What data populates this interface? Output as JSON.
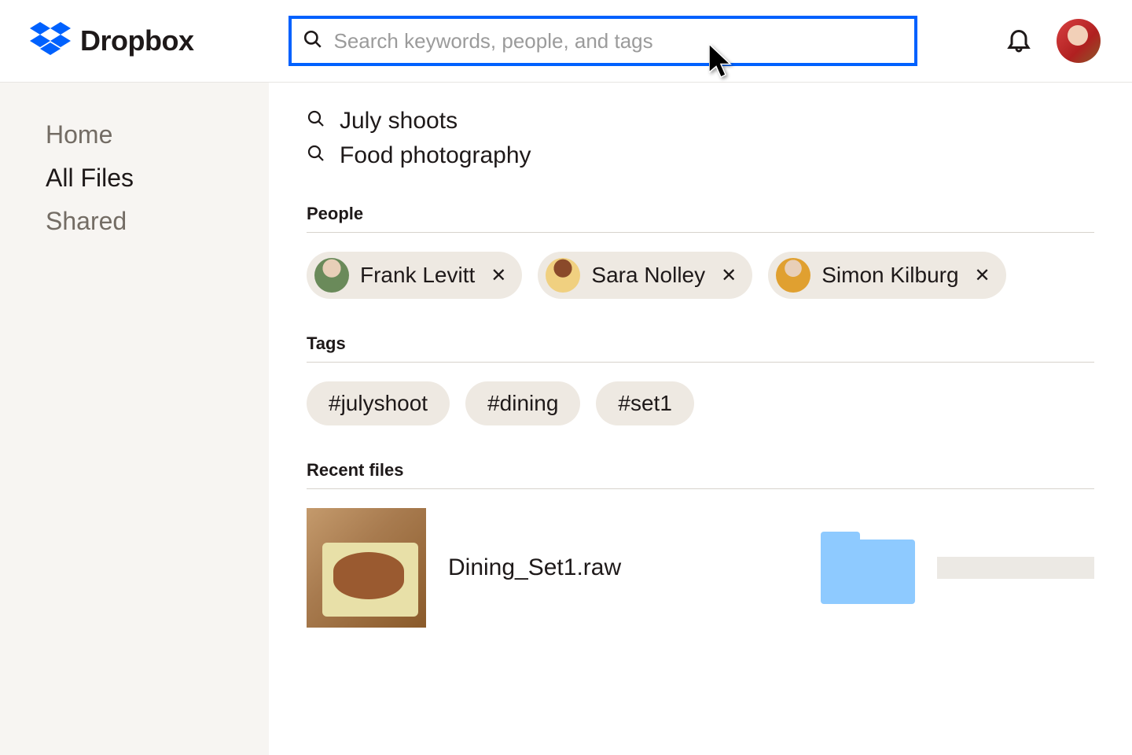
{
  "brand": {
    "name": "Dropbox"
  },
  "search": {
    "placeholder": "Search keywords, people, and tags",
    "value": ""
  },
  "sidebar": {
    "items": [
      {
        "label": "Home",
        "active": false
      },
      {
        "label": "All Files",
        "active": true
      },
      {
        "label": "Shared",
        "active": false
      }
    ]
  },
  "suggestions": [
    {
      "label": "July shoots"
    },
    {
      "label": "Food photography"
    }
  ],
  "sections": {
    "people_title": "People",
    "tags_title": "Tags",
    "recent_title": "Recent files"
  },
  "people": [
    {
      "name": "Frank Levitt",
      "avatar_hue": "#6a8a5a"
    },
    {
      "name": "Sara Nolley",
      "avatar_hue": "#d08a30"
    },
    {
      "name": "Simon Kilburg",
      "avatar_hue": "#e0a030"
    }
  ],
  "tags": [
    {
      "label": "#julyshoot"
    },
    {
      "label": "#dining"
    },
    {
      "label": "#set1"
    }
  ],
  "recent_files": [
    {
      "name": "Dining_Set1.raw",
      "type": "image"
    },
    {
      "name": "",
      "type": "folder"
    },
    {
      "name": "",
      "type": "placeholder"
    }
  ]
}
